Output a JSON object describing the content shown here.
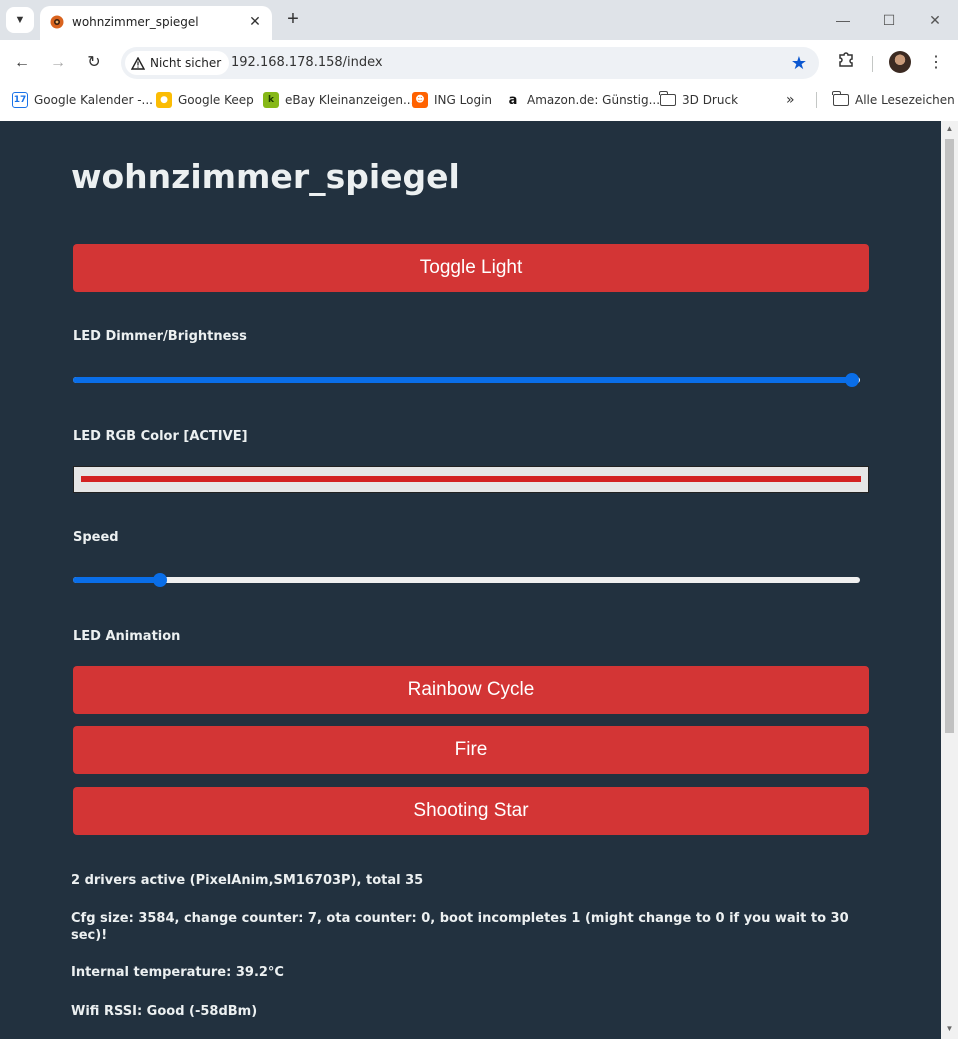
{
  "browser": {
    "tab_title": "wohnzimmer_spiegel",
    "security_label": "Nicht sicher",
    "url": "192.168.178.158/index",
    "bookmarks": [
      {
        "label": "Google Kalender -...",
        "icon": "calendar-icon",
        "color": "#1a73e8"
      },
      {
        "label": "Google Keep",
        "icon": "keep-icon",
        "color": "#fbbc04"
      },
      {
        "label": "eBay Kleinanzeigen...",
        "icon": "ebay-kleinanzeigen-icon",
        "color": "#86b817"
      },
      {
        "label": "ING Login",
        "icon": "ing-icon",
        "color": "#ff6200"
      },
      {
        "label": "Amazon.de: Günstig...",
        "icon": "amazon-icon",
        "color": "#ffffff"
      },
      {
        "label": "3D Druck",
        "icon": "folder-icon"
      }
    ],
    "all_bookmarks_label": "Alle Lesezeichen"
  },
  "page": {
    "title": "wohnzimmer_spiegel",
    "toggle_button": "Toggle Light",
    "brightness": {
      "label": "LED Dimmer/Brightness",
      "value_percent": 99
    },
    "rgb": {
      "label": "LED RGB Color [ACTIVE]",
      "color": "#d32222"
    },
    "speed": {
      "label": "Speed",
      "value_percent": 11
    },
    "animation": {
      "label": "LED Animation",
      "buttons": [
        "Rainbow Cycle",
        "Fire",
        "Shooting Star"
      ]
    },
    "info": {
      "drivers": "2 drivers active (PixelAnim,SM16703P), total 35",
      "cfg": "Cfg size: 3584, change counter: 7, ota counter: 0, boot incompletes 1 (might change to 0 if you wait to 30 sec)!",
      "temperature": "Internal temperature: 39.2°C",
      "wifi": "Wifi RSSI: Good (-58dBm)"
    },
    "accent_color": "#d33535",
    "slider_color": "#0a6ee8"
  }
}
